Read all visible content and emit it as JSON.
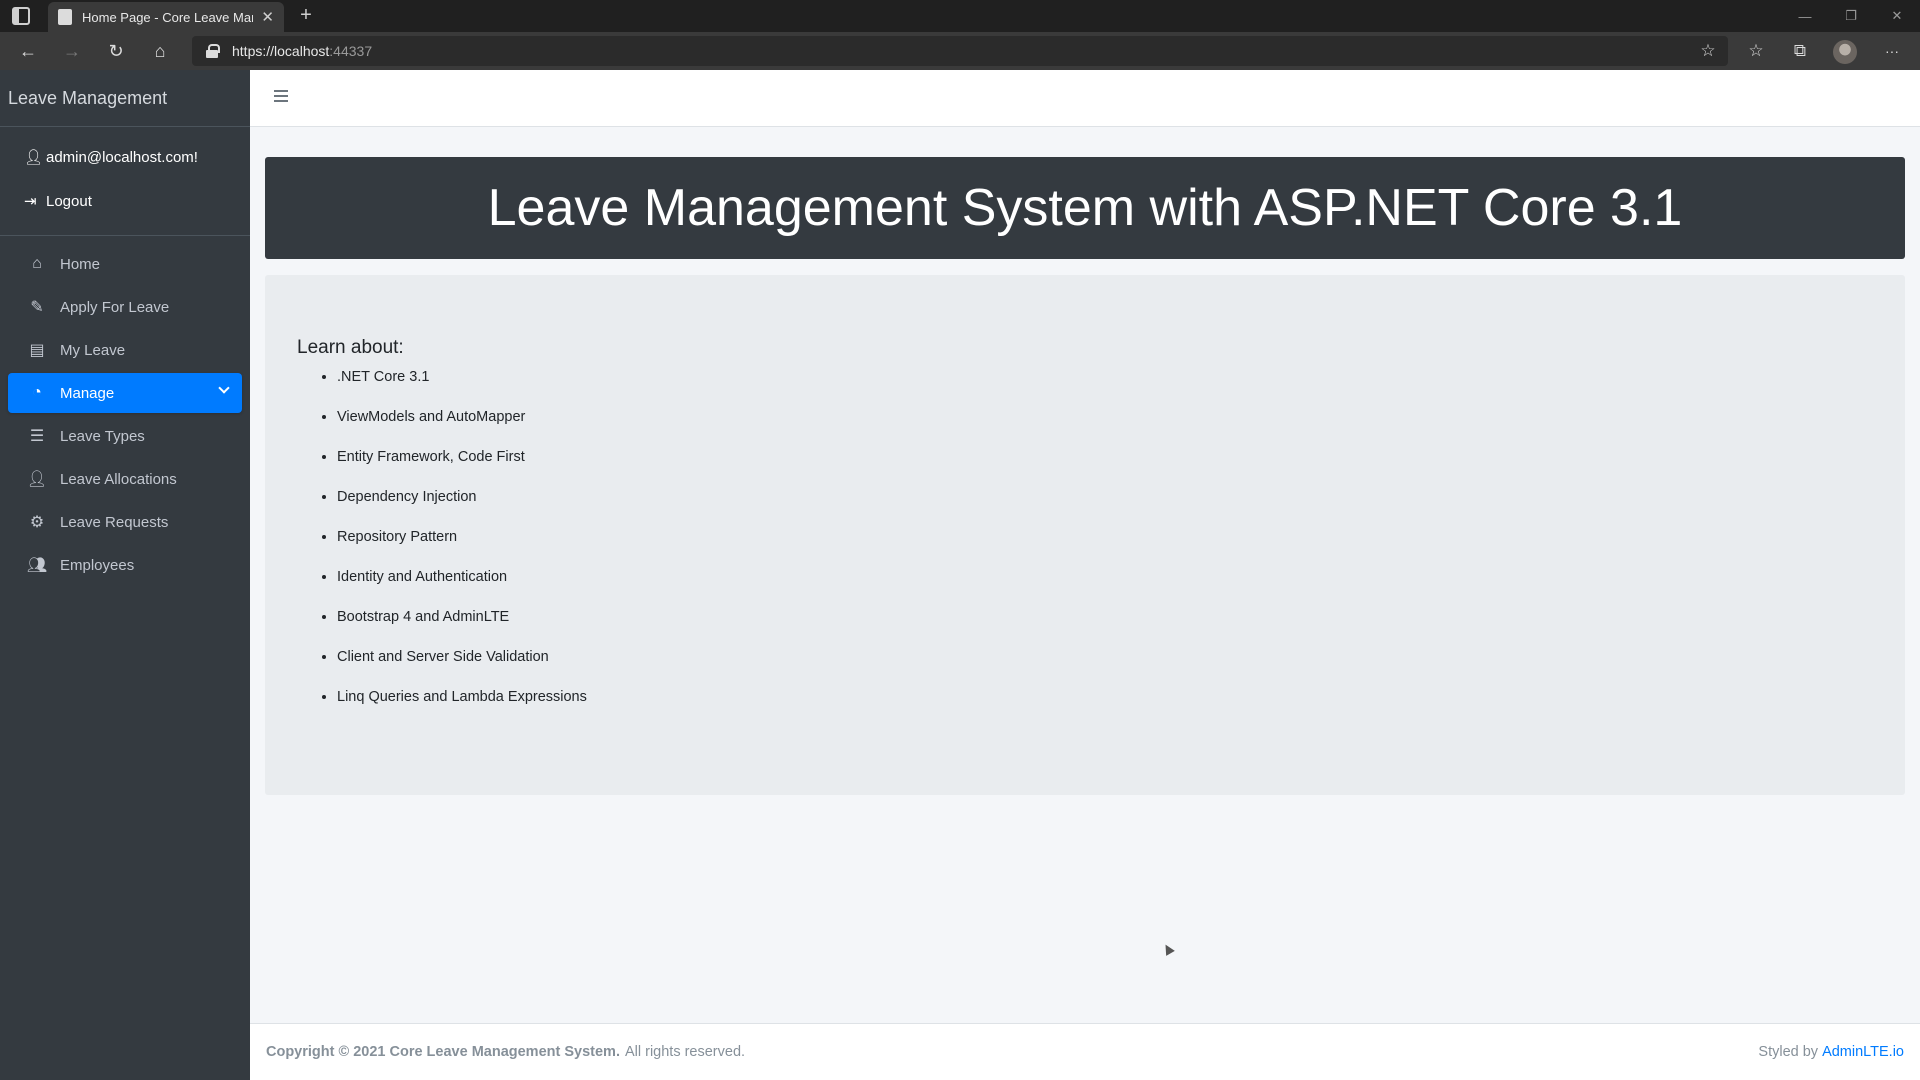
{
  "browser": {
    "tab_title": "Home Page - Core Leave Manag",
    "url_host": "https://localhost",
    "url_port": ":44337",
    "controls": {
      "minimize": "—",
      "restore": "❐",
      "close": "✕",
      "new_tab": "+",
      "tab_close": "✕",
      "back": "←",
      "forward": "→",
      "reload": "↻",
      "home": "⌂",
      "favorite": "☆",
      "favorites_list": "☆",
      "collections": "⧉",
      "more": "···"
    }
  },
  "sidebar": {
    "brand": "Leave Management",
    "user": {
      "email": "admin@localhost.com!",
      "logout": "Logout"
    },
    "items": [
      {
        "label": "Home",
        "icon": "home-icon"
      },
      {
        "label": "Apply For Leave",
        "icon": "pencil-icon"
      },
      {
        "label": "My Leave",
        "icon": "book-icon"
      },
      {
        "label": "Manage",
        "icon": "tachometer-icon",
        "active": true
      },
      {
        "label": "Leave Types",
        "icon": "list-icon"
      },
      {
        "label": "Leave Allocations",
        "icon": "user-plus-icon"
      },
      {
        "label": "Leave Requests",
        "icon": "cogs-icon"
      },
      {
        "label": "Employees",
        "icon": "users-icon"
      }
    ]
  },
  "main": {
    "banner_title": "Leave Management System with ASP.NET Core 3.1",
    "learn_heading": "Learn about:",
    "topics": [
      ".NET Core 3.1",
      "ViewModels and AutoMapper",
      "Entity Framework, Code First",
      "Dependency Injection",
      "Repository Pattern",
      "Identity and Authentication",
      "Bootstrap 4 and AdminLTE",
      "Client and Server Side Validation",
      "Linq Queries and Lambda Expressions"
    ]
  },
  "footer": {
    "copyright": "Copyright © 2021 Core Leave Management System.",
    "rights": "All rights reserved.",
    "styled_by": "Styled by",
    "link": "AdminLTE.io"
  },
  "colors": {
    "sidebar_bg": "#343a40",
    "accent": "#007bff",
    "content_bg": "#f4f6f9",
    "card_bg": "#e9ecef"
  }
}
